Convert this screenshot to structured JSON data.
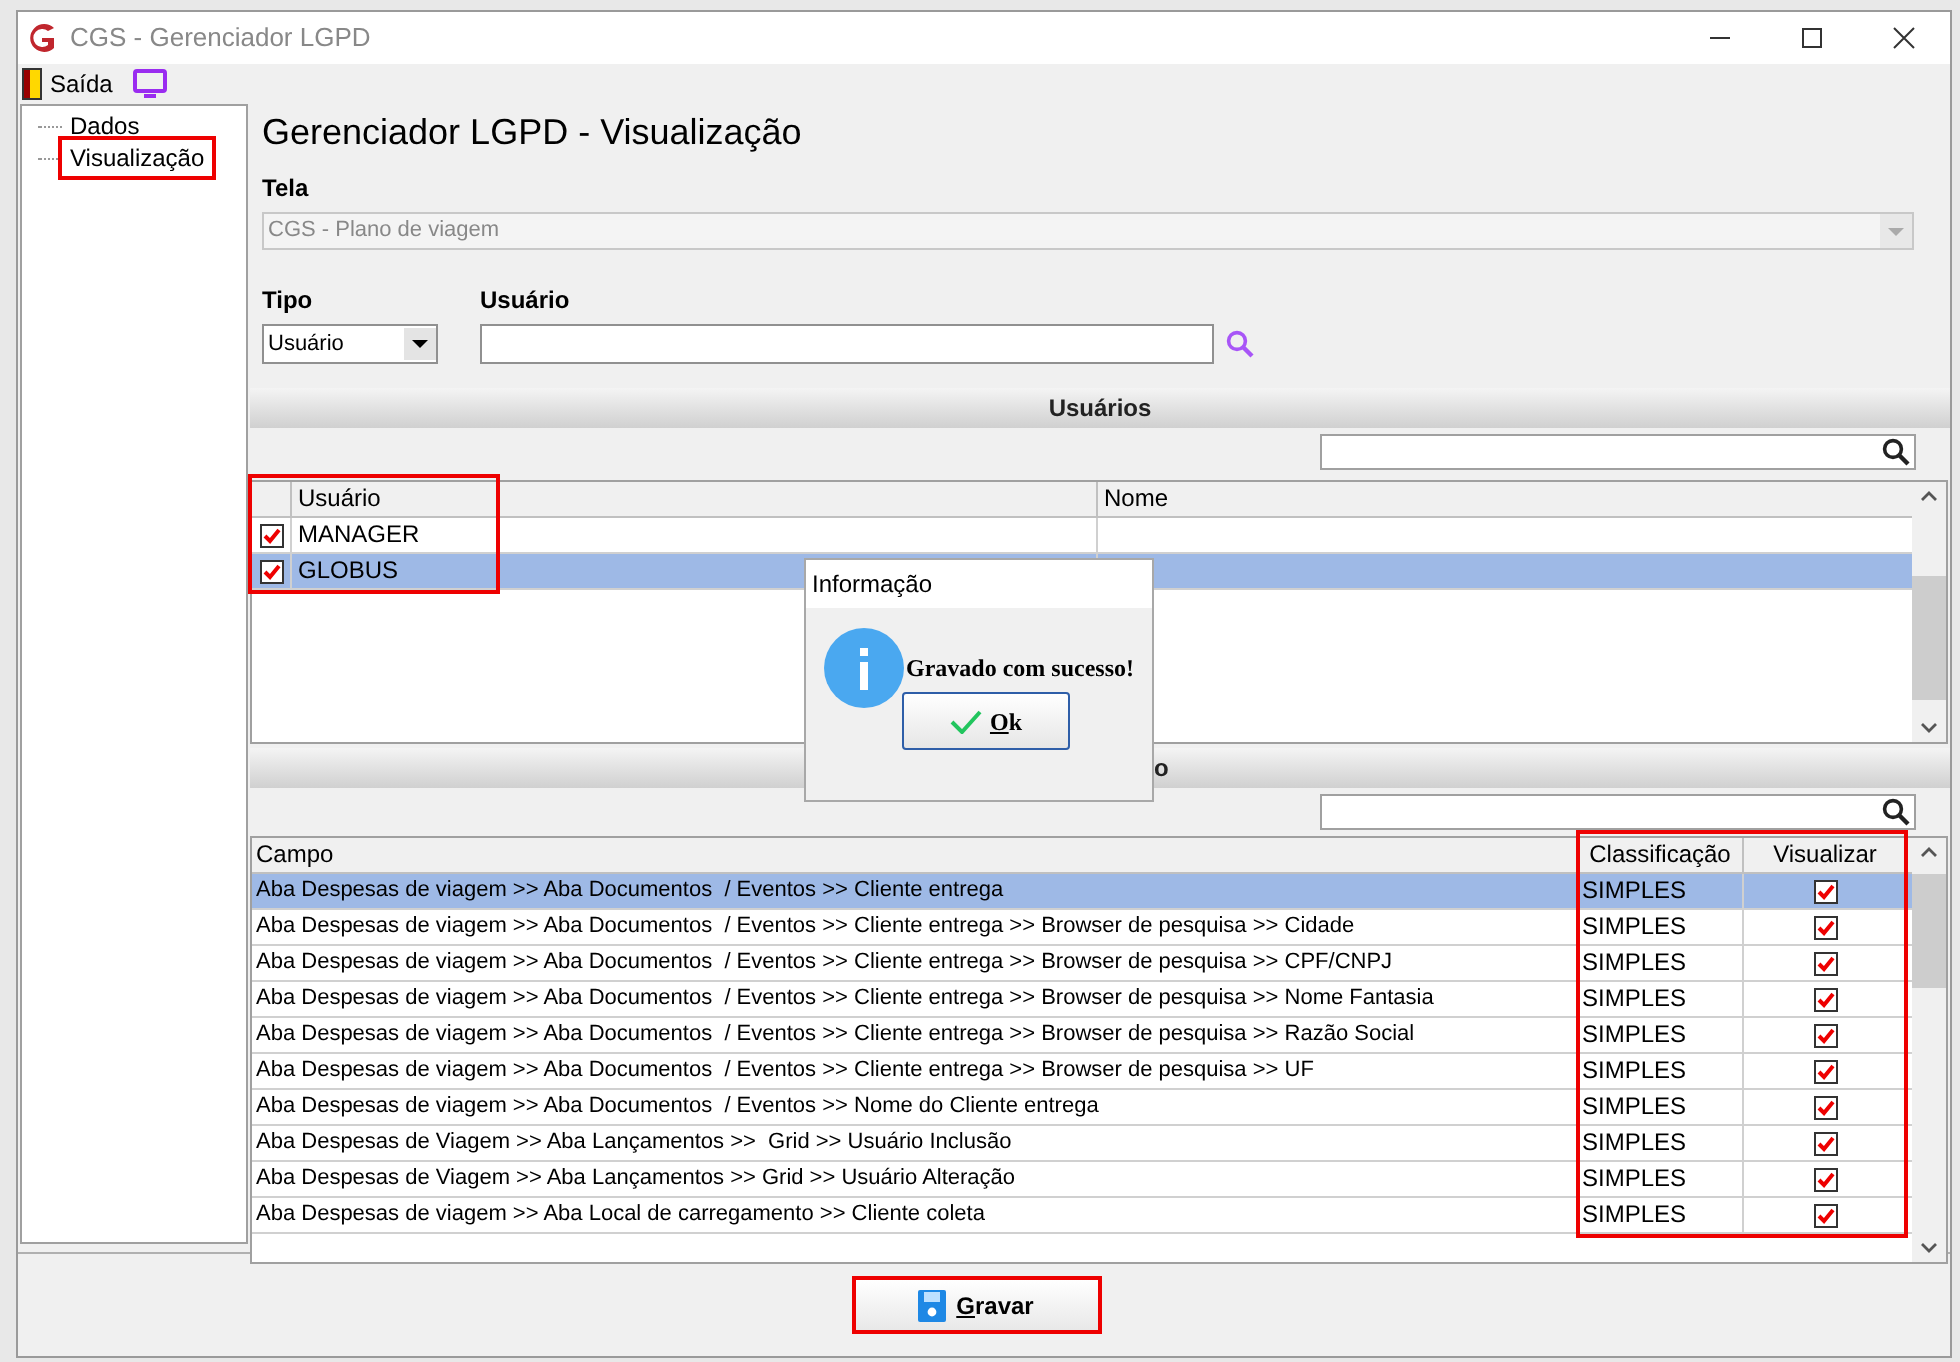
{
  "window": {
    "title": "CGS - Gerenciador LGPD"
  },
  "toolbar": {
    "exit_label": "Saída"
  },
  "tree": [
    {
      "label": "Dados",
      "highlighted": false
    },
    {
      "label": "Visualização",
      "highlighted": true
    }
  ],
  "heading": "Gerenciador LGPD - Visualização",
  "tela": {
    "label": "Tela",
    "value": "CGS - Plano de viagem",
    "disabled": true
  },
  "tipo": {
    "label": "Tipo",
    "value": "Usuário"
  },
  "usuario": {
    "label": "Usuário"
  },
  "users_section": {
    "title": "Usuários",
    "highlighted": true,
    "columns": [
      "Usuário",
      "Nome"
    ],
    "rows": [
      {
        "usuario": "MANAGER",
        "checked": true,
        "selected": false
      },
      {
        "usuario": "GLOBUS",
        "checked": true,
        "selected": true
      }
    ]
  },
  "fields_section": {
    "title": "o",
    "highlighted": true,
    "columns": [
      "Campo",
      "Classificação",
      "Visualizar"
    ],
    "rows": [
      {
        "campo": "Aba Despesas de viagem >> Aba Documentos  / Eventos >> Cliente entrega",
        "classificacao": "SIMPLES",
        "visualizar": true,
        "selected": true
      },
      {
        "campo": "Aba Despesas de viagem >> Aba Documentos  / Eventos >> Cliente entrega >> Browser de pesquisa >> Cidade",
        "classificacao": "SIMPLES",
        "visualizar": true,
        "selected": false
      },
      {
        "campo": "Aba Despesas de viagem >> Aba Documentos  / Eventos >> Cliente entrega >> Browser de pesquisa >> CPF/CNPJ",
        "classificacao": "SIMPLES",
        "visualizar": true,
        "selected": false
      },
      {
        "campo": "Aba Despesas de viagem >> Aba Documentos  / Eventos >> Cliente entrega >> Browser de pesquisa >> Nome Fantasia",
        "classificacao": "SIMPLES",
        "visualizar": true,
        "selected": false
      },
      {
        "campo": "Aba Despesas de viagem >> Aba Documentos  / Eventos >> Cliente entrega >> Browser de pesquisa >> Razão Social",
        "classificacao": "SIMPLES",
        "visualizar": true,
        "selected": false
      },
      {
        "campo": "Aba Despesas de viagem >> Aba Documentos  / Eventos >> Cliente entrega >> Browser de pesquisa >> UF",
        "classificacao": "SIMPLES",
        "visualizar": true,
        "selected": false
      },
      {
        "campo": "Aba Despesas de viagem >> Aba Documentos  / Eventos >> Nome do Cliente entrega",
        "classificacao": "SIMPLES",
        "visualizar": true,
        "selected": false
      },
      {
        "campo": "Aba Despesas de Viagem >> Aba Lançamentos >>  Grid >> Usuário Inclusão",
        "classificacao": "SIMPLES",
        "visualizar": true,
        "selected": false
      },
      {
        "campo": "Aba Despesas de Viagem >> Aba Lançamentos >> Grid >> Usuário Alteração",
        "classificacao": "SIMPLES",
        "visualizar": true,
        "selected": false
      },
      {
        "campo": "Aba Despesas de viagem >> Aba Local de carregamento >> Cliente coleta",
        "classificacao": "SIMPLES",
        "visualizar": true,
        "selected": false
      }
    ]
  },
  "dialog": {
    "title": "Informação",
    "message": "Gravado com sucesso!",
    "button": "Ok"
  },
  "save_button": {
    "label": "Gravar",
    "highlighted": true
  }
}
